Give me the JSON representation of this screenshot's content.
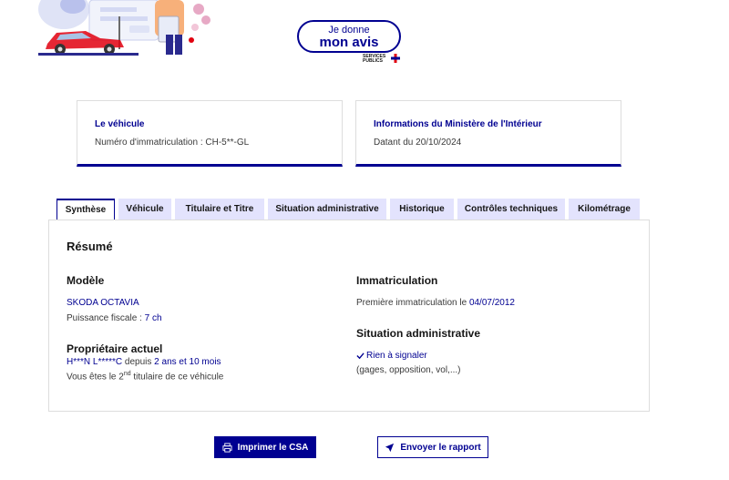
{
  "feedback": {
    "line1": "Je donne",
    "line2": "mon avis",
    "brand_line1": "SERVICES",
    "brand_line2": "PUBLICS"
  },
  "vehicle_card": {
    "title": "Le véhicule",
    "text": "Numéro d'immatriculation : CH-5**-GL"
  },
  "ministry_card": {
    "title": "Informations du Ministère de l'Intérieur",
    "text": "Datant du 20/10/2024"
  },
  "tabs": [
    {
      "label": "Synthèse",
      "active": true
    },
    {
      "label": "Véhicule",
      "active": false
    },
    {
      "label": "Titulaire et Titre",
      "active": false
    },
    {
      "label": "Situation administrative",
      "active": false
    },
    {
      "label": "Historique",
      "active": false
    },
    {
      "label": "Contrôles techniques",
      "active": false
    },
    {
      "label": "Kilométrage",
      "active": false
    }
  ],
  "summary": {
    "title": "Résumé",
    "model": {
      "heading": "Modèle",
      "name": "SKODA OCTAVIA",
      "power_label": "Puissance fiscale : ",
      "power_value": "7 ch"
    },
    "owner": {
      "heading": "Propriétaire actuel",
      "name": "H***N L*****C",
      "since_label": " depuis ",
      "since_value": "2 ans et 10 mois",
      "holder_prefix": "Vous êtes le 2",
      "holder_sup": "nd",
      "holder_suffix": " titulaire de ce véhicule"
    },
    "registration": {
      "heading": "Immatriculation",
      "first_label": "Première immatriculation le ",
      "first_value": "04/07/2012"
    },
    "admin": {
      "heading": "Situation administrative",
      "status": "Rien à signaler",
      "details": "(gages, opposition, vol,...)"
    }
  },
  "actions": {
    "print_label": "Imprimer le CSA",
    "send_label": "Envoyer le rapport"
  },
  "colors": {
    "primary": "#000091",
    "tab_bg": "#e3e3fd",
    "text": "#161616"
  }
}
